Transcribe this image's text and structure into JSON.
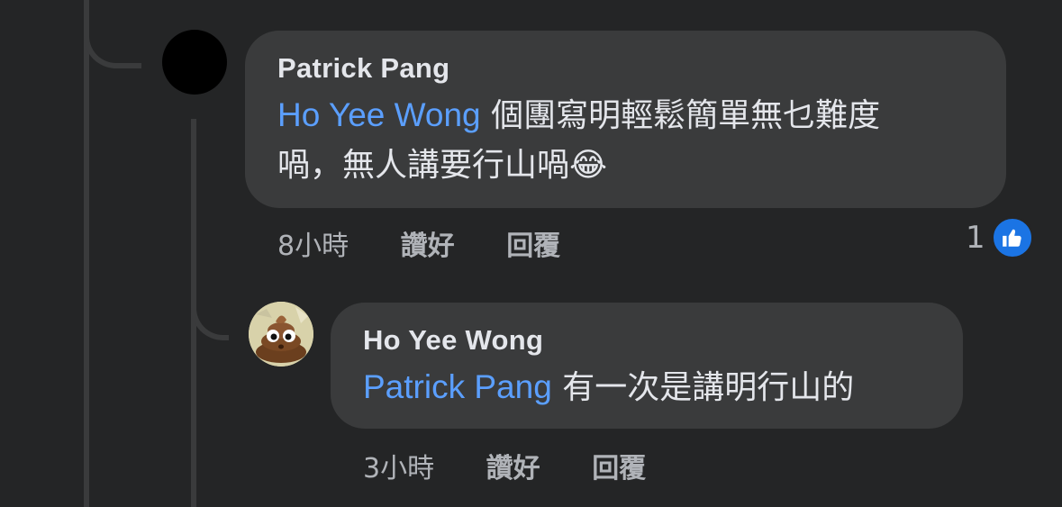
{
  "comments": [
    {
      "author": "Patrick Pang",
      "mention": "Ho Yee Wong",
      "text_line1": " 個團寫明輕鬆簡單無乜難度",
      "text_line2": "喎，無人講要行山喎",
      "emoji": "😂",
      "time": "8小時",
      "like_label": "讚好",
      "reply_label": "回覆",
      "reaction_count": "1",
      "reaction_icon": "like-thumbs-up-icon",
      "avatar": "black-circle-avatar"
    },
    {
      "author": "Ho Yee Wong",
      "mention": "Patrick Pang",
      "text_line1": " 有一次是講明行山的",
      "time": "3小時",
      "like_label": "讚好",
      "reply_label": "回覆",
      "avatar": "poop-emoji-avatar"
    }
  ],
  "colors": {
    "background": "#242526",
    "bubble": "#3a3b3c",
    "mention": "#5b9fff",
    "like_badge": "#1b74e4"
  }
}
